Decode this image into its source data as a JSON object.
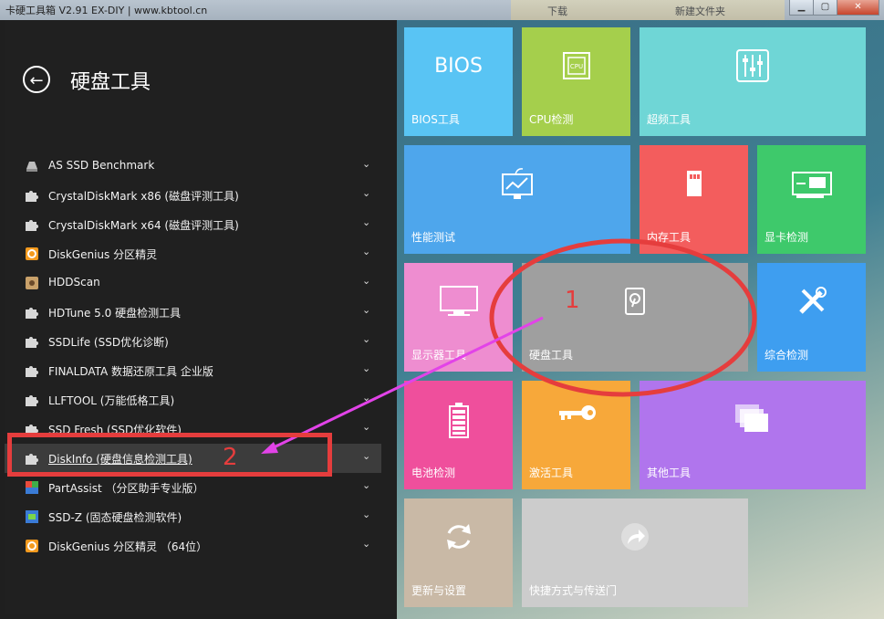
{
  "window": {
    "title": "卡硬工具箱 V2.91   EX-DIY    |   www.kbtool.cn",
    "ghost_tab1": "下载",
    "ghost_tab2": "新建文件夹"
  },
  "panel": {
    "title": "硬盘工具",
    "back_icon": "back-arrow-icon"
  },
  "tools": [
    {
      "label": "AS SSD Benchmark",
      "icon": "drive-icon",
      "color": "#bdbdbd"
    },
    {
      "label": "CrystalDiskMark x86 (磁盘评测工具)",
      "icon": "puzzle-icon",
      "color": "#d8d8d8"
    },
    {
      "label": "CrystalDiskMark x64 (磁盘评测工具)",
      "icon": "puzzle-icon",
      "color": "#d8d8d8"
    },
    {
      "label": "DiskGenius 分区精灵",
      "icon": "diskgenius-icon",
      "color": "#f39a1e"
    },
    {
      "label": "HDDScan",
      "icon": "hddscan-icon",
      "color": "#c9a16a"
    },
    {
      "label": "HDTune 5.0 硬盘检测工具",
      "icon": "puzzle-icon",
      "color": "#d8d8d8"
    },
    {
      "label": "SSDLife (SSD优化诊断)",
      "icon": "puzzle-icon",
      "color": "#d8d8d8"
    },
    {
      "label": "FINALDATA 数据还原工具 企业版",
      "icon": "puzzle-icon",
      "color": "#d8d8d8"
    },
    {
      "label": "LLFTOOL (万能低格工具)",
      "icon": "puzzle-icon",
      "color": "#d8d8d8"
    },
    {
      "label": "SSD Fresh (SSD优化软件)",
      "icon": "puzzle-icon",
      "color": "#d8d8d8"
    },
    {
      "label": "DiskInfo (硬盘信息检测工具)",
      "icon": "puzzle-icon",
      "color": "#d8d8d8",
      "selected": true
    },
    {
      "label": "PartAssist （分区助手专业版）",
      "icon": "partassist-icon",
      "color": "#3fae49"
    },
    {
      "label": "SSD-Z (固态硬盘检测软件)",
      "icon": "ssdz-icon",
      "color": "#3a7bd5"
    },
    {
      "label": "DiskGenius 分区精灵 （64位）",
      "icon": "diskgenius-icon",
      "color": "#f39a1e"
    }
  ],
  "tiles": [
    {
      "key": "bios",
      "label": "BIOS工具",
      "icon": "bios-text-icon",
      "icon_text": "BIOS",
      "color": "#59c4f4"
    },
    {
      "key": "cpu",
      "label": "CPU检测",
      "icon": "cpu-icon",
      "icon_text": "CPU",
      "color": "#a5cf4c"
    },
    {
      "key": "overclock",
      "label": "超频工具",
      "icon": "sliders-icon",
      "color": "#6fd6d6"
    },
    {
      "key": "performance",
      "label": "性能测试",
      "icon": "monitor-chart-icon",
      "color": "#4ea6ec"
    },
    {
      "key": "memory",
      "label": "内存工具",
      "icon": "memory-card-icon",
      "color": "#f35d5d"
    },
    {
      "key": "gpu",
      "label": "显卡检测",
      "icon": "graphics-card-icon",
      "color": "#3ec96b"
    },
    {
      "key": "display",
      "label": "显示器工具",
      "icon": "display-icon",
      "color": "#ee8dd0"
    },
    {
      "key": "disk",
      "label": "硬盘工具",
      "icon": "hard-disk-icon",
      "color": "#9f9f9f"
    },
    {
      "key": "general",
      "label": "综合检测",
      "icon": "tools-icon",
      "color": "#3e9ef0"
    },
    {
      "key": "battery",
      "label": "电池检测",
      "icon": "battery-icon",
      "color": "#ef4f9c"
    },
    {
      "key": "activation",
      "label": "激活工具",
      "icon": "key-icon",
      "color": "#f7a83a"
    },
    {
      "key": "other",
      "label": "其他工具",
      "icon": "windows-stack-icon",
      "color": "#b075ed"
    },
    {
      "key": "update",
      "label": "更新与设置",
      "icon": "refresh-icon",
      "color": "#c9b9a6"
    },
    {
      "key": "shortcut",
      "label": "快捷方式与传送门",
      "icon": "share-arrow-icon",
      "color": "#cccccc"
    }
  ],
  "annotations": {
    "num1": "1",
    "num2": "2",
    "color": "#e53d3d",
    "arrow_color": "#e243e8"
  }
}
